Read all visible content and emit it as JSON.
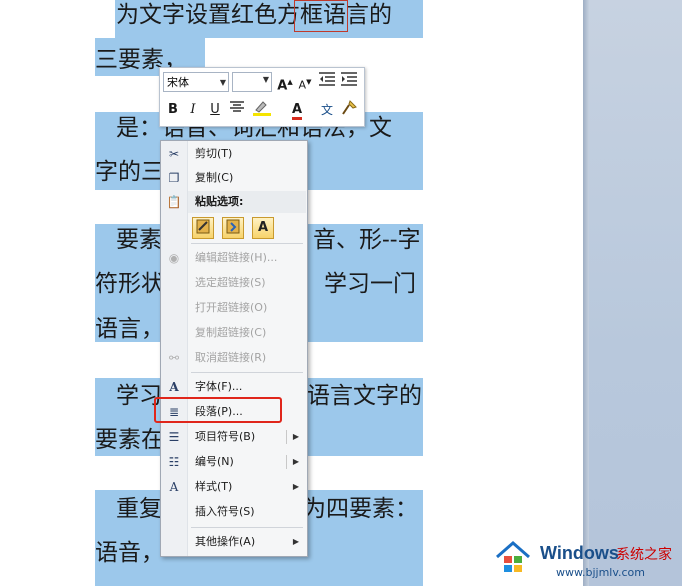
{
  "document": {
    "lines": [
      {
        "id": "line-1",
        "text": "为文字设置红色方框语言的"
      },
      {
        "id": "line-2",
        "text": "三要素，"
      },
      {
        "id": "line-3",
        "text": "是：语音、词汇和语法，文"
      },
      {
        "id": "line-4",
        "text": "字的三"
      },
      {
        "id": "line-5",
        "text": "要素"
      },
      {
        "id": "line-6",
        "text": "音、形--字"
      },
      {
        "id": "line-7",
        "text": "符形状"
      },
      {
        "id": "line-8",
        "text": "学习一门"
      },
      {
        "id": "line-9",
        "text": "语言，"
      },
      {
        "id": "line-10",
        "text": "学习"
      },
      {
        "id": "line-11",
        "text": "语言文字的"
      },
      {
        "id": "line-12",
        "text": "要素在"
      },
      {
        "id": "line-13",
        "text": "重复"
      },
      {
        "id": "line-14",
        "text": "为四要素："
      },
      {
        "id": "line-15",
        "text": "语音，"
      }
    ]
  },
  "mini_toolbar": {
    "font_name": "宋体",
    "font_size": "",
    "buttons": {
      "grow_font": "A",
      "shrink_font": "A",
      "bold": "B",
      "italic": "I",
      "underline": "U",
      "font_color": "A",
      "phonetic": "文"
    }
  },
  "context_menu": {
    "cut": "剪切(T)",
    "copy": "复制(C)",
    "paste_options_title": "粘贴选项:",
    "paste_keep_text": "A",
    "edit_hyperlink": "编辑超链接(H)...",
    "select_hyperlink": "选定超链接(S)",
    "open_hyperlink": "打开超链接(O)",
    "copy_hyperlink": "复制超链接(C)",
    "remove_hyperlink": "取消超链接(R)",
    "font": "字体(F)...",
    "paragraph": "段落(P)...",
    "bullets": "项目符号(B)",
    "numbering": "编号(N)",
    "styles": "样式(T)",
    "insert_symbol": "插入符号(S)",
    "other_actions": "其他操作(A)"
  },
  "watermark": {
    "brand": "Windows",
    "sub": "系统之家",
    "url": "www.bjjmlv.com"
  },
  "colors": {
    "selection_highlight": "#9cc8eb",
    "annotation_red": "#e0261b"
  }
}
